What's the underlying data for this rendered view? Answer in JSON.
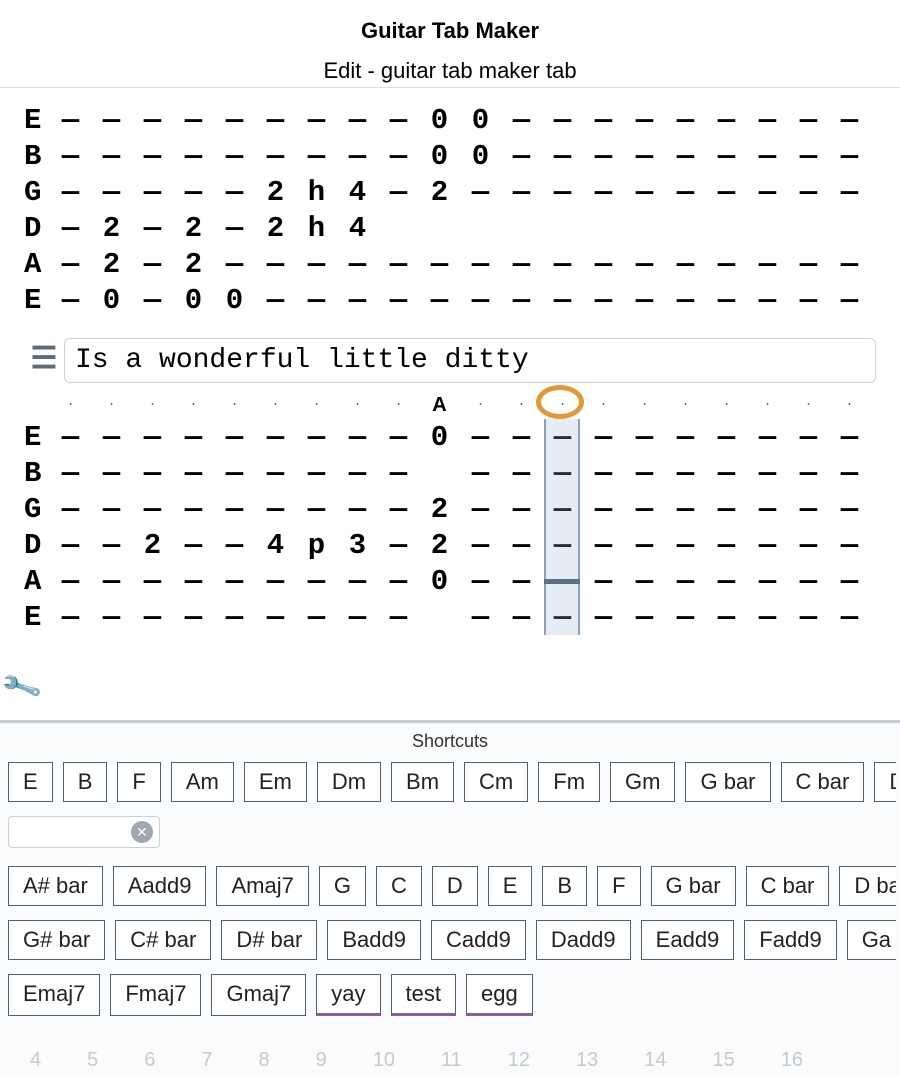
{
  "app": {
    "title": "Guitar Tab Maker",
    "subtitle": "Edit - guitar tab maker tab"
  },
  "columns": 20,
  "strings": [
    "E",
    "B",
    "G",
    "D",
    "A",
    "E"
  ],
  "section1": {
    "rows": [
      [
        "-",
        "-",
        "-",
        "-",
        "-",
        "-",
        "-",
        "-",
        "-",
        "0",
        "0",
        "-",
        "-",
        "-",
        "-",
        "-",
        "-",
        "-",
        "-",
        "-"
      ],
      [
        "-",
        "-",
        "-",
        "-",
        "-",
        "-",
        "-",
        "-",
        "-",
        "0",
        "0",
        "-",
        "-",
        "-",
        "-",
        "-",
        "-",
        "-",
        "-",
        "-"
      ],
      [
        "-",
        "-",
        "-",
        "-",
        "-",
        "2",
        "h",
        "4",
        "-",
        "2",
        "-",
        "-",
        "-",
        "-",
        "-",
        "-",
        "-",
        "-",
        "-",
        "-"
      ],
      [
        "-",
        "2",
        "-",
        "2",
        "-",
        "2",
        "h",
        "4",
        " ",
        " ",
        " ",
        " ",
        " ",
        " ",
        " ",
        " ",
        " ",
        " ",
        " ",
        " "
      ],
      [
        "-",
        "2",
        "-",
        "2",
        "-",
        "-",
        "-",
        "-",
        "-",
        "-",
        "-",
        "-",
        "-",
        "-",
        "-",
        "-",
        "-",
        "-",
        "-",
        "-"
      ],
      [
        "-",
        "0",
        "-",
        "0",
        "0",
        "-",
        "-",
        "-",
        "-",
        "-",
        "-",
        "-",
        "-",
        "-",
        "-",
        "-",
        "-",
        "-",
        "-",
        "-"
      ]
    ]
  },
  "lyric": {
    "value": "Is a wonderful little ditty"
  },
  "section2": {
    "markers": [
      ".",
      ".",
      ".",
      ".",
      ".",
      ".",
      ".",
      ".",
      ".",
      "A",
      ".",
      ".",
      ".",
      ".",
      ".",
      ".",
      ".",
      ".",
      ".",
      "."
    ],
    "cursorCol": 12,
    "circleCol": 12,
    "rows": [
      [
        "-",
        "-",
        "-",
        "-",
        "-",
        "-",
        "-",
        "-",
        "-",
        "0",
        "-",
        "-",
        "-",
        "-",
        "-",
        "-",
        "-",
        "-",
        "-",
        "-"
      ],
      [
        "-",
        "-",
        "-",
        "-",
        "-",
        "-",
        "-",
        "-",
        "-",
        " ",
        "-",
        "-",
        "-",
        "-",
        "-",
        "-",
        "-",
        "-",
        "-",
        "-"
      ],
      [
        "-",
        "-",
        "-",
        "-",
        "-",
        "-",
        "-",
        "-",
        "-",
        "2",
        "-",
        "-",
        "-",
        "-",
        "-",
        "-",
        "-",
        "-",
        "-",
        "-"
      ],
      [
        "-",
        "-",
        "2",
        "-",
        "-",
        "4",
        "p",
        "3",
        "-",
        "2",
        "-",
        "-",
        "-",
        "-",
        "-",
        "-",
        "-",
        "-",
        "-",
        "-"
      ],
      [
        "-",
        "-",
        "-",
        "-",
        "-",
        "-",
        "-",
        "-",
        "-",
        "0",
        "-",
        "-",
        "-",
        "-",
        "-",
        "-",
        "-",
        "-",
        "-",
        "-"
      ],
      [
        "-",
        "-",
        "-",
        "-",
        "-",
        "-",
        "-",
        "-",
        "-",
        " ",
        "-",
        "-",
        "-",
        "-",
        "-",
        "-",
        "-",
        "-",
        "-",
        "-"
      ]
    ]
  },
  "icons": {
    "settings": "wrench-icon",
    "menu": "menu-icon",
    "clear": "clear-icon"
  },
  "shortcuts": {
    "title": "Shortcuts",
    "row1": [
      "E",
      "B",
      "F",
      "Am",
      "Em",
      "Dm",
      "Bm",
      "Cm",
      "Fm",
      "Gm",
      "G bar",
      "C bar",
      "D"
    ],
    "search": {
      "value": ""
    },
    "row2": [
      "A# bar",
      "Aadd9",
      "Amaj7",
      "G",
      "C",
      "D",
      "E",
      "B",
      "F",
      "G bar",
      "C bar",
      "D bar"
    ],
    "row3": [
      "G# bar",
      "C# bar",
      "D# bar",
      "Badd9",
      "Cadd9",
      "Dadd9",
      "Eadd9",
      "Fadd9",
      "Ga"
    ],
    "row4": [
      "Emaj7",
      "Fmaj7",
      "Gmaj7",
      "yay",
      "test",
      "egg"
    ],
    "userChips": [
      "yay",
      "test",
      "egg"
    ]
  },
  "fretNumbers": [
    "4",
    "5",
    "6",
    "7",
    "8",
    "9",
    "10",
    "11",
    "12",
    "13",
    "14",
    "15",
    "16"
  ]
}
